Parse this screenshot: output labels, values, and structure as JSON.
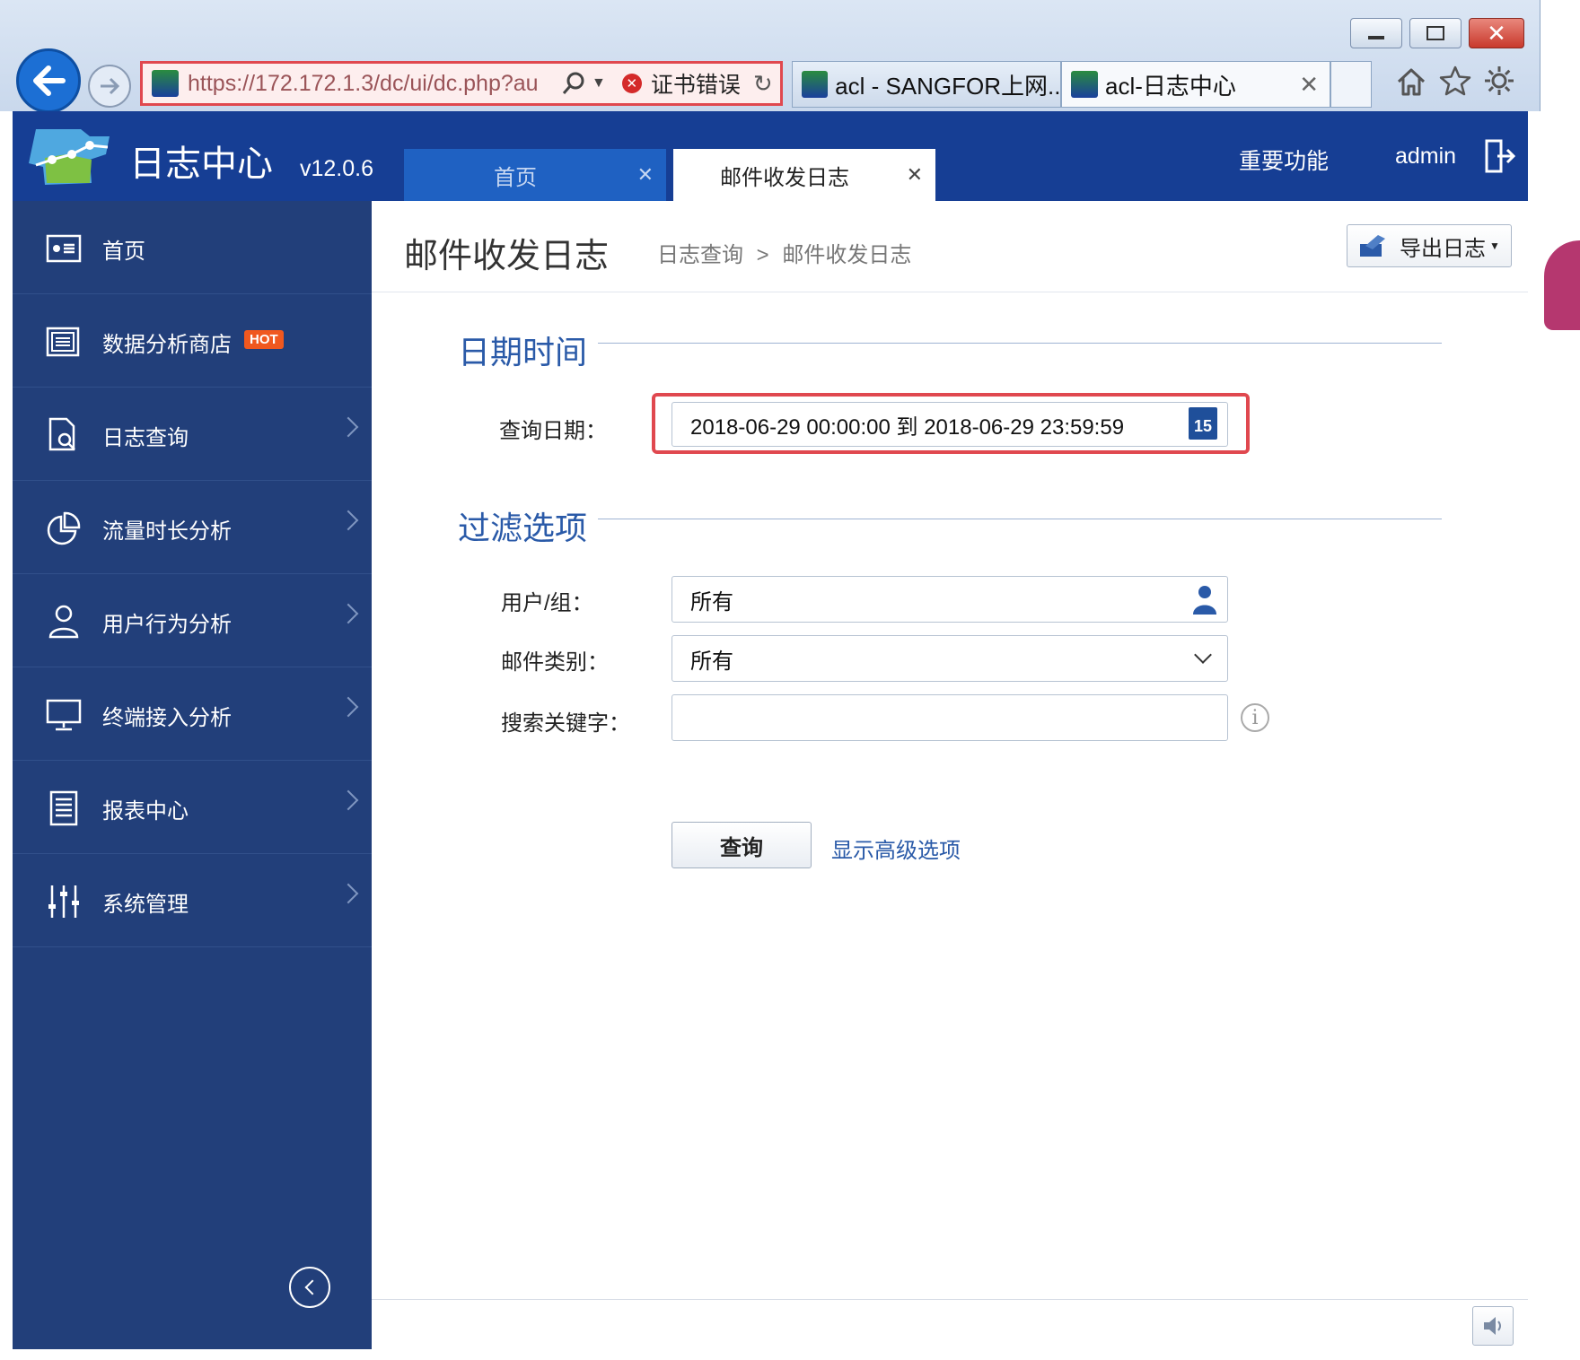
{
  "browser": {
    "address": "https://172.172.1.3/dc/ui/dc.php?au",
    "cert_error": "证书错误",
    "tabs": [
      {
        "label": "acl - SANGFOR上网..."
      },
      {
        "label": "acl-日志中心"
      }
    ]
  },
  "header": {
    "app_name": "日志中心",
    "version": "v12.0.6",
    "tabs": [
      {
        "label": "首页"
      },
      {
        "label": "邮件收发日志"
      }
    ],
    "important": "重要功能",
    "user": "admin"
  },
  "sidebar": {
    "items": [
      {
        "label": "首页",
        "icon": "dashboard-icon"
      },
      {
        "label": "数据分析商店",
        "icon": "store-icon",
        "badge": "HOT"
      },
      {
        "label": "日志查询",
        "icon": "log-search-icon"
      },
      {
        "label": "流量时长分析",
        "icon": "pie-chart-icon"
      },
      {
        "label": "用户行为分析",
        "icon": "user-icon"
      },
      {
        "label": "终端接入分析",
        "icon": "monitor-icon"
      },
      {
        "label": "报表中心",
        "icon": "report-icon"
      },
      {
        "label": "系统管理",
        "icon": "sliders-icon"
      }
    ]
  },
  "page": {
    "title": "邮件收发日志",
    "breadcrumb": {
      "parent": "日志查询",
      "sep": ">",
      "current": "邮件收发日志"
    },
    "export": "导出日志",
    "date_section": "日期时间",
    "date_label": "查询日期：",
    "date_value": "2018-06-29 00:00:00 到 2018-06-29 23:59:59",
    "calendar_day": "15",
    "filter_section": "过滤选项",
    "user_label": "用户/组：",
    "user_value": "所有",
    "mail_label": "邮件类别：",
    "mail_value": "所有",
    "keyword_label": "搜索关键字：",
    "keyword_value": "",
    "query_button": "查询",
    "advanced_link": "显示高级选项"
  },
  "colors": {
    "header": "#163e94",
    "sidebar": "#223f7a",
    "accent": "#2a5aa8",
    "highlight": "#e0484f"
  }
}
